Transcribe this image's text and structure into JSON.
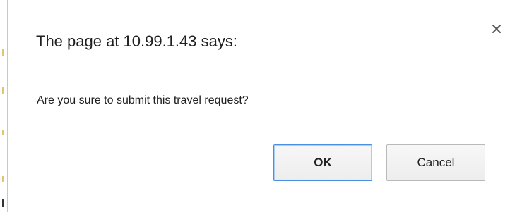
{
  "dialog": {
    "title": "The page at 10.99.1.43 says:",
    "message": "Are you sure to submit this travel request?",
    "close_icon": "close-icon",
    "ok_label": "OK",
    "cancel_label": "Cancel"
  },
  "colors": {
    "focus_border": "#4a90e2",
    "text": "#202020"
  }
}
